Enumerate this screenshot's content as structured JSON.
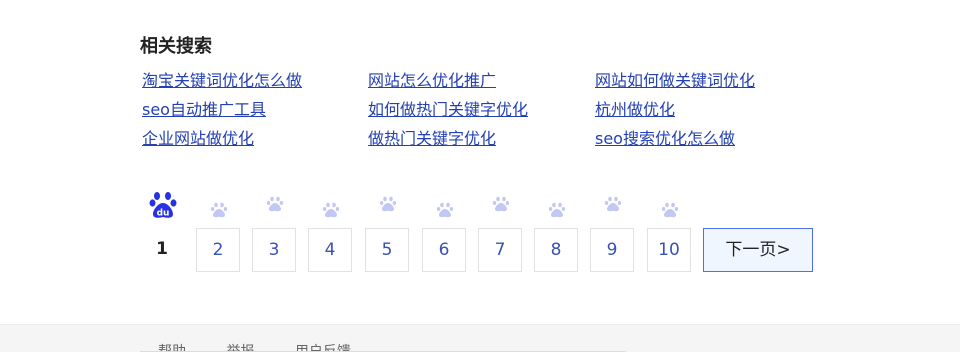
{
  "related_searches": {
    "title": "相关搜索",
    "links": [
      "淘宝关键词优化怎么做",
      "网站怎么优化推广",
      "网站如何做关键词优化",
      "seo自动推广工具",
      "如何做热门关键字优化",
      "杭州做优化",
      "企业网站做优化",
      "做热门关键字优化",
      "seo搜索优化怎么做"
    ]
  },
  "pagination": {
    "current_page": "1",
    "pages": [
      "2",
      "3",
      "4",
      "5",
      "6",
      "7",
      "8",
      "9",
      "10"
    ],
    "next_label": "下一页>",
    "logo_icon": "baidu-paw-icon",
    "paw_icon": "paw-icon",
    "colors": {
      "link": "#2440b3",
      "logo": "#2932e1",
      "paw_inactive": "#c2c8f2",
      "next_border": "#4e6ef2"
    }
  },
  "footer": {
    "links": [
      "帮助",
      "举报",
      "用户反馈"
    ]
  }
}
